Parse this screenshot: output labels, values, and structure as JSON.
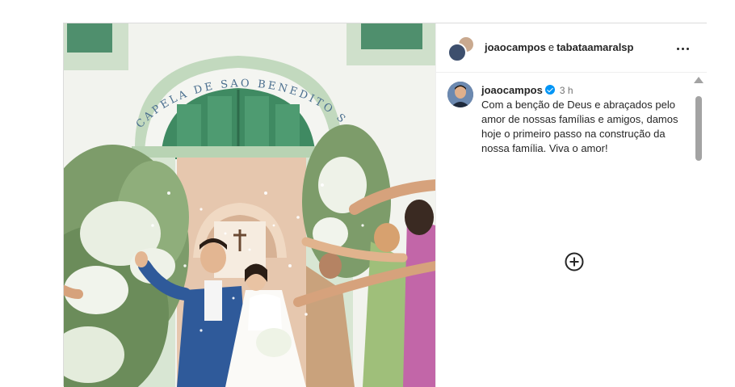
{
  "header": {
    "user1": "joaocampos",
    "conjunction": "e",
    "user2": "tabataamaralsp"
  },
  "caption": {
    "username": "joaocampos",
    "time": "3 h",
    "text": "Com a benção de Deus e abraçados pelo amor de nossas famílias e amigos, damos hoje o primeiro passo na construção da nossa família. Viva o amor!"
  },
  "photo": {
    "sign_text": "CAPELA DE SAO BENEDITO SEC XVIII"
  },
  "icons": {
    "more": "more-horizontal-icon",
    "add": "add-circle-icon",
    "verified": "verified-badge-icon"
  },
  "colors": {
    "verified": "#0095f6",
    "chapel_wall": "#f2f3ee",
    "chapel_trim": "#a9c9a4",
    "door": "#3f8a62",
    "suit": "#2f5a9a"
  }
}
